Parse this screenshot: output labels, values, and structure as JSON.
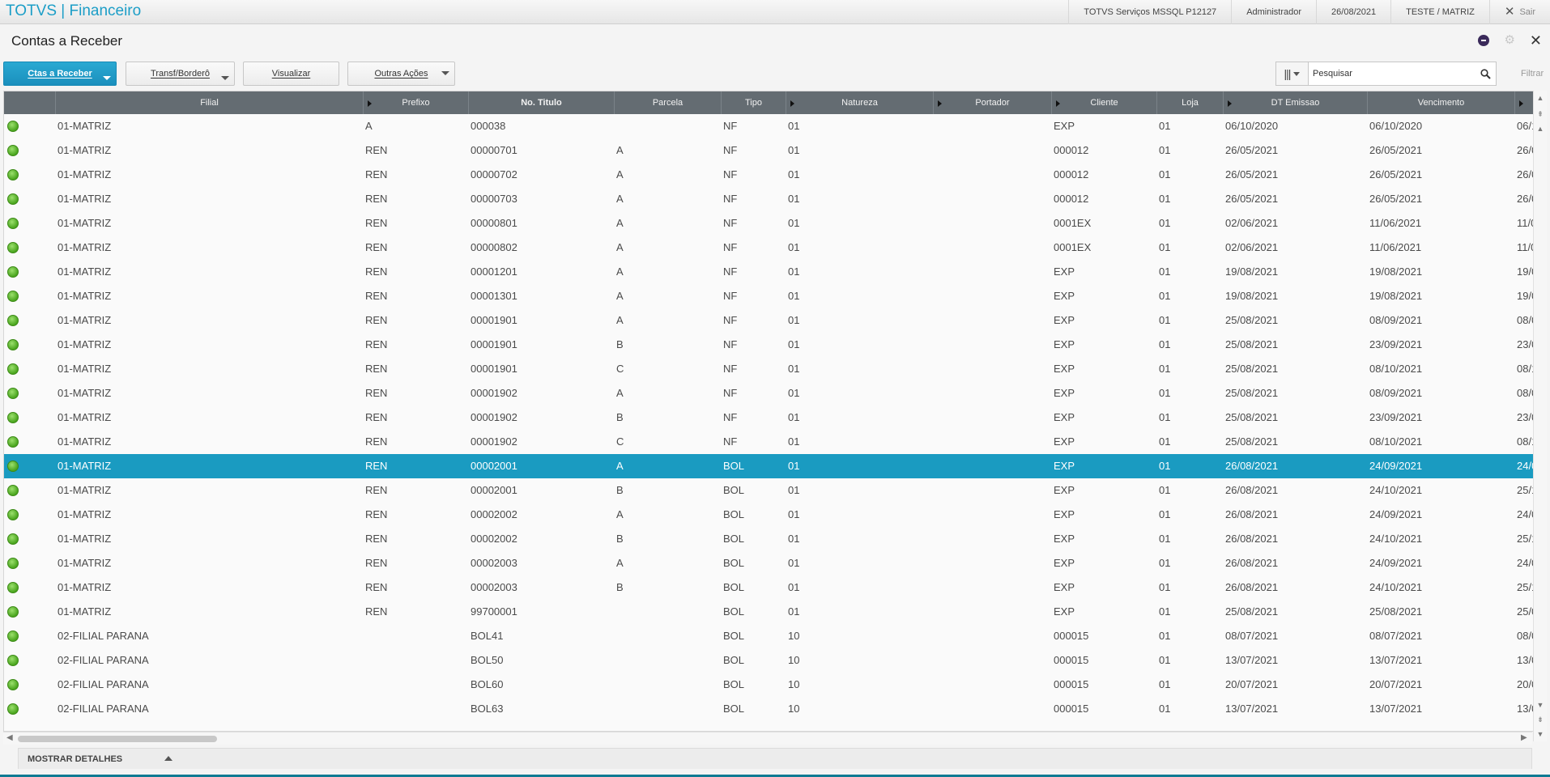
{
  "app": {
    "title": "TOTVS | Financeiro"
  },
  "topbar": {
    "environment": "TOTVS Serviços MSSQL P12127",
    "user": "Administrador",
    "date": "26/08/2021",
    "branch": "TESTE / MATRIZ",
    "exit_label": "Sair"
  },
  "page": {
    "title": "Contas a Receber"
  },
  "toolbar": {
    "btn_ctas": "Ctas a Receber",
    "btn_transf": "Transf/Borderô",
    "btn_visualizar": "Visualizar",
    "btn_outras": "Outras Ações",
    "search_placeholder": "Pesquisar",
    "filter_label": "Filtrar"
  },
  "columns": [
    "Filial",
    "Prefixo",
    "No. Titulo",
    "Parcela",
    "Tipo",
    "Natureza",
    "Portador",
    "Cliente",
    "Loja",
    "DT Emissao",
    "Vencimento"
  ],
  "rows": [
    {
      "filial": "01-MATRIZ",
      "prefixo": "A",
      "titulo": "000038",
      "parcela": "",
      "tipo": "NF",
      "natureza": "01",
      "cliente": "EXP",
      "loja": "01",
      "emissao": "06/10/2020",
      "vencimento": "06/10/2020",
      "extra": "06/1"
    },
    {
      "filial": "01-MATRIZ",
      "prefixo": "REN",
      "titulo": "00000701",
      "parcela": "A",
      "tipo": "NF",
      "natureza": "01",
      "cliente": "000012",
      "loja": "01",
      "emissao": "26/05/2021",
      "vencimento": "26/05/2021",
      "extra": "26/0"
    },
    {
      "filial": "01-MATRIZ",
      "prefixo": "REN",
      "titulo": "00000702",
      "parcela": "A",
      "tipo": "NF",
      "natureza": "01",
      "cliente": "000012",
      "loja": "01",
      "emissao": "26/05/2021",
      "vencimento": "26/05/2021",
      "extra": "26/0"
    },
    {
      "filial": "01-MATRIZ",
      "prefixo": "REN",
      "titulo": "00000703",
      "parcela": "A",
      "tipo": "NF",
      "natureza": "01",
      "cliente": "000012",
      "loja": "01",
      "emissao": "26/05/2021",
      "vencimento": "26/05/2021",
      "extra": "26/0"
    },
    {
      "filial": "01-MATRIZ",
      "prefixo": "REN",
      "titulo": "00000801",
      "parcela": "A",
      "tipo": "NF",
      "natureza": "01",
      "cliente": "0001EX",
      "loja": "01",
      "emissao": "02/06/2021",
      "vencimento": "11/06/2021",
      "extra": "11/0"
    },
    {
      "filial": "01-MATRIZ",
      "prefixo": "REN",
      "titulo": "00000802",
      "parcela": "A",
      "tipo": "NF",
      "natureza": "01",
      "cliente": "0001EX",
      "loja": "01",
      "emissao": "02/06/2021",
      "vencimento": "11/06/2021",
      "extra": "11/0"
    },
    {
      "filial": "01-MATRIZ",
      "prefixo": "REN",
      "titulo": "00001201",
      "parcela": "A",
      "tipo": "NF",
      "natureza": "01",
      "cliente": "EXP",
      "loja": "01",
      "emissao": "19/08/2021",
      "vencimento": "19/08/2021",
      "extra": "19/0"
    },
    {
      "filial": "01-MATRIZ",
      "prefixo": "REN",
      "titulo": "00001301",
      "parcela": "A",
      "tipo": "NF",
      "natureza": "01",
      "cliente": "EXP",
      "loja": "01",
      "emissao": "19/08/2021",
      "vencimento": "19/08/2021",
      "extra": "19/0"
    },
    {
      "filial": "01-MATRIZ",
      "prefixo": "REN",
      "titulo": "00001901",
      "parcela": "A",
      "tipo": "NF",
      "natureza": "01",
      "cliente": "EXP",
      "loja": "01",
      "emissao": "25/08/2021",
      "vencimento": "08/09/2021",
      "extra": "08/0"
    },
    {
      "filial": "01-MATRIZ",
      "prefixo": "REN",
      "titulo": "00001901",
      "parcela": "B",
      "tipo": "NF",
      "natureza": "01",
      "cliente": "EXP",
      "loja": "01",
      "emissao": "25/08/2021",
      "vencimento": "23/09/2021",
      "extra": "23/0"
    },
    {
      "filial": "01-MATRIZ",
      "prefixo": "REN",
      "titulo": "00001901",
      "parcela": "C",
      "tipo": "NF",
      "natureza": "01",
      "cliente": "EXP",
      "loja": "01",
      "emissao": "25/08/2021",
      "vencimento": "08/10/2021",
      "extra": "08/1"
    },
    {
      "filial": "01-MATRIZ",
      "prefixo": "REN",
      "titulo": "00001902",
      "parcela": "A",
      "tipo": "NF",
      "natureza": "01",
      "cliente": "EXP",
      "loja": "01",
      "emissao": "25/08/2021",
      "vencimento": "08/09/2021",
      "extra": "08/0"
    },
    {
      "filial": "01-MATRIZ",
      "prefixo": "REN",
      "titulo": "00001902",
      "parcela": "B",
      "tipo": "NF",
      "natureza": "01",
      "cliente": "EXP",
      "loja": "01",
      "emissao": "25/08/2021",
      "vencimento": "23/09/2021",
      "extra": "23/0"
    },
    {
      "filial": "01-MATRIZ",
      "prefixo": "REN",
      "titulo": "00001902",
      "parcela": "C",
      "tipo": "NF",
      "natureza": "01",
      "cliente": "EXP",
      "loja": "01",
      "emissao": "25/08/2021",
      "vencimento": "08/10/2021",
      "extra": "08/1"
    },
    {
      "filial": "01-MATRIZ",
      "prefixo": "REN",
      "titulo": "00002001",
      "parcela": "A",
      "tipo": "BOL",
      "natureza": "01",
      "cliente": "EXP",
      "loja": "01",
      "emissao": "26/08/2021",
      "vencimento": "24/09/2021",
      "extra": "24/0",
      "selected": true
    },
    {
      "filial": "01-MATRIZ",
      "prefixo": "REN",
      "titulo": "00002001",
      "parcela": "B",
      "tipo": "BOL",
      "natureza": "01",
      "cliente": "EXP",
      "loja": "01",
      "emissao": "26/08/2021",
      "vencimento": "24/10/2021",
      "extra": "25/1"
    },
    {
      "filial": "01-MATRIZ",
      "prefixo": "REN",
      "titulo": "00002002",
      "parcela": "A",
      "tipo": "BOL",
      "natureza": "01",
      "cliente": "EXP",
      "loja": "01",
      "emissao": "26/08/2021",
      "vencimento": "24/09/2021",
      "extra": "24/0"
    },
    {
      "filial": "01-MATRIZ",
      "prefixo": "REN",
      "titulo": "00002002",
      "parcela": "B",
      "tipo": "BOL",
      "natureza": "01",
      "cliente": "EXP",
      "loja": "01",
      "emissao": "26/08/2021",
      "vencimento": "24/10/2021",
      "extra": "25/1"
    },
    {
      "filial": "01-MATRIZ",
      "prefixo": "REN",
      "titulo": "00002003",
      "parcela": "A",
      "tipo": "BOL",
      "natureza": "01",
      "cliente": "EXP",
      "loja": "01",
      "emissao": "26/08/2021",
      "vencimento": "24/09/2021",
      "extra": "24/0"
    },
    {
      "filial": "01-MATRIZ",
      "prefixo": "REN",
      "titulo": "00002003",
      "parcela": "B",
      "tipo": "BOL",
      "natureza": "01",
      "cliente": "EXP",
      "loja": "01",
      "emissao": "26/08/2021",
      "vencimento": "24/10/2021",
      "extra": "25/1"
    },
    {
      "filial": "01-MATRIZ",
      "prefixo": "REN",
      "titulo": "99700001",
      "parcela": "",
      "tipo": "BOL",
      "natureza": "01",
      "cliente": "EXP",
      "loja": "01",
      "emissao": "25/08/2021",
      "vencimento": "25/08/2021",
      "extra": "25/0"
    },
    {
      "filial": "02-FILIAL PARANA",
      "prefixo": "",
      "titulo": "BOL41",
      "parcela": "",
      "tipo": "BOL",
      "natureza": "10",
      "cliente": "000015",
      "loja": "01",
      "emissao": "08/07/2021",
      "vencimento": "08/07/2021",
      "extra": "08/0"
    },
    {
      "filial": "02-FILIAL PARANA",
      "prefixo": "",
      "titulo": "BOL50",
      "parcela": "",
      "tipo": "BOL",
      "natureza": "10",
      "cliente": "000015",
      "loja": "01",
      "emissao": "13/07/2021",
      "vencimento": "13/07/2021",
      "extra": "13/0"
    },
    {
      "filial": "02-FILIAL PARANA",
      "prefixo": "",
      "titulo": "BOL60",
      "parcela": "",
      "tipo": "BOL",
      "natureza": "10",
      "cliente": "000015",
      "loja": "01",
      "emissao": "20/07/2021",
      "vencimento": "20/07/2021",
      "extra": "20/0"
    },
    {
      "filial": "02-FILIAL PARANA",
      "prefixo": "",
      "titulo": "BOL63",
      "parcela": "",
      "tipo": "BOL",
      "natureza": "10",
      "cliente": "000015",
      "loja": "01",
      "emissao": "13/07/2021",
      "vencimento": "13/07/2021",
      "extra": "13/0"
    }
  ],
  "footer": {
    "details_label": "MOSTRAR DETALHES"
  },
  "colors": {
    "accent": "#1c9ec7",
    "selected_row": "#1a9bc1",
    "header_bg": "#646c72",
    "status_ok": "#4aa51e"
  },
  "icons": {
    "legend_dot": "status-ok-icon",
    "search": "search-icon",
    "columns": "columns-icon",
    "close": "close-icon",
    "gear": "gear-icon"
  }
}
